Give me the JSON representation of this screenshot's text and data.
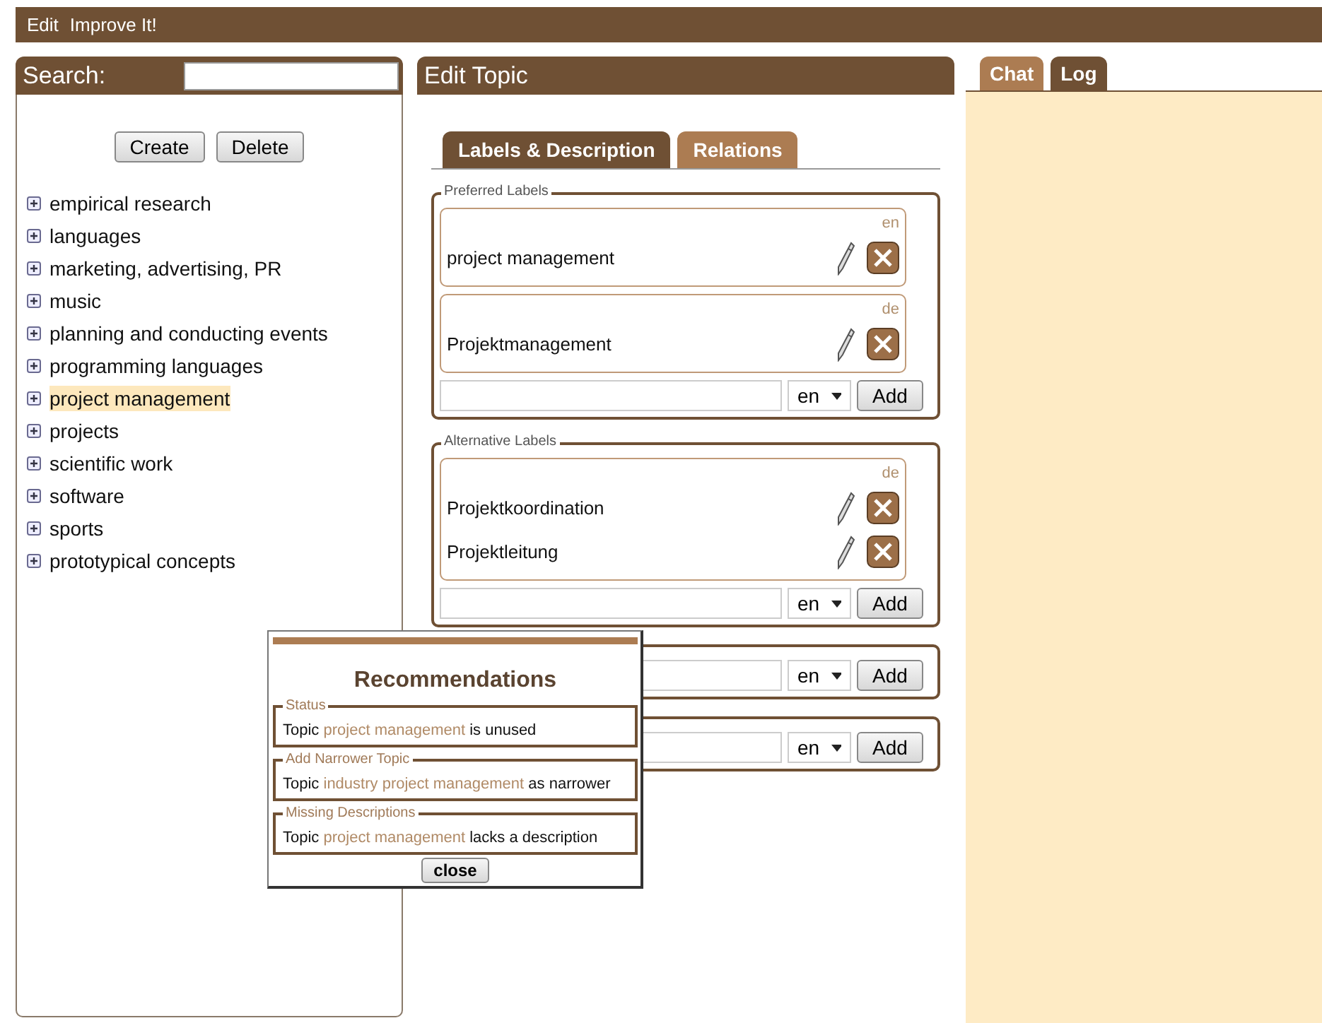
{
  "menu": [
    {
      "label": "Edit"
    },
    {
      "label": "Improve It!"
    }
  ],
  "search": {
    "label": "Search:"
  },
  "tree_buttons": [
    "Create",
    "Delete"
  ],
  "topics": [
    {
      "label": "empirical research",
      "selected": false,
      "expanded": false
    },
    {
      "label": "languages",
      "selected": false,
      "expanded": false
    },
    {
      "label": "marketing, advertising, PR",
      "selected": false,
      "expanded": false
    },
    {
      "label": "music",
      "selected": false,
      "expanded": false
    },
    {
      "label": "planning and conducting events",
      "selected": false,
      "expanded": false
    },
    {
      "label": "programming languages",
      "selected": false,
      "expanded": false
    },
    {
      "label": "project management",
      "selected": true,
      "expanded": false
    },
    {
      "label": "projects",
      "selected": false,
      "expanded": false
    },
    {
      "label": "scientific work",
      "selected": false,
      "expanded": false
    },
    {
      "label": "software",
      "selected": false,
      "expanded": false
    },
    {
      "label": "sports",
      "selected": false,
      "expanded": false
    },
    {
      "label": "prototypical concepts",
      "selected": false,
      "expanded": false
    }
  ],
  "editor": {
    "title": "Edit Topic",
    "tabs": [
      {
        "label": "Labels & Description",
        "selected": true
      },
      {
        "label": "Relations",
        "selected": false
      }
    ],
    "groups": [
      {
        "legend": "Preferred Labels",
        "entries": [
          {
            "lang": "en",
            "items": [
              "project management"
            ]
          },
          {
            "lang": "de",
            "items": [
              "Projektmanagement"
            ]
          }
        ],
        "language": "en",
        "add_button": "Add"
      },
      {
        "legend": "Alternative Labels",
        "entries": [
          {
            "lang": "de",
            "items": [
              "Projektkoordination",
              "Projektleitung"
            ]
          }
        ],
        "language": "en",
        "add_button": "Add"
      },
      {
        "language": "en",
        "add_button": "Add"
      },
      {
        "language": "en",
        "add_button": "Add"
      }
    ]
  },
  "recommendations": {
    "title": "Recommendations",
    "sections": [
      {
        "legend": "Status",
        "prefix": "Topic",
        "topic": "project management",
        "suffix": "is unused"
      },
      {
        "legend": "Add Narrower Topic",
        "prefix": "Topic",
        "topic": "industry project management",
        "suffix": "as narrower"
      },
      {
        "legend": "Missing Descriptions",
        "prefix": "Topic",
        "topic": "project management",
        "suffix": "lacks a description"
      }
    ],
    "close_button": "close"
  },
  "side_tabs": [
    {
      "label": "Chat",
      "selected": false
    },
    {
      "label": "Log",
      "selected": true
    }
  ]
}
